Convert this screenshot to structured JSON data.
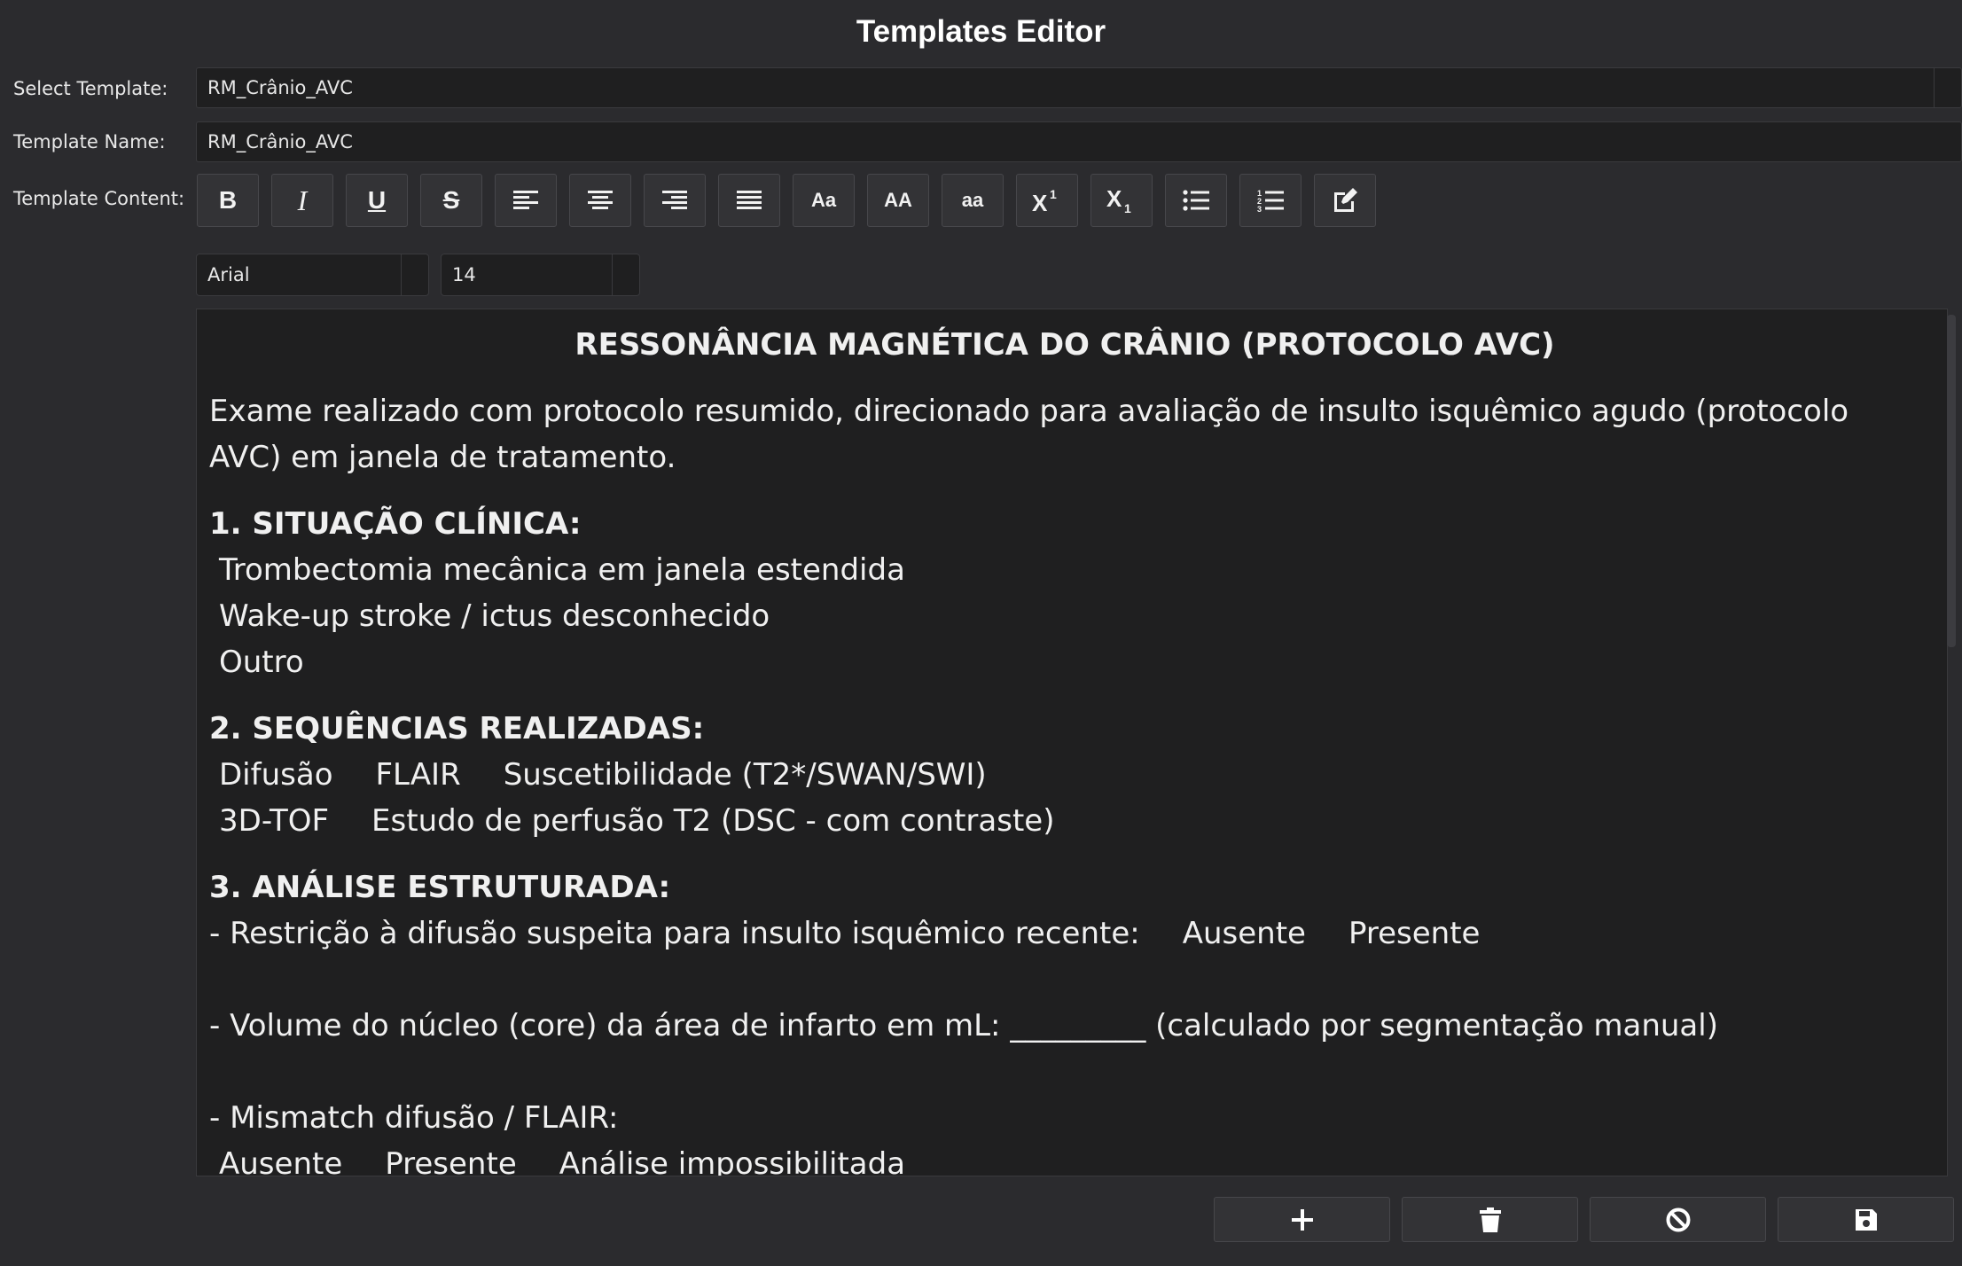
{
  "window": {
    "title": "Templates Editor"
  },
  "labels": {
    "select_template": "Select Template:",
    "template_name": "Template Name:",
    "template_content": "Template Content:"
  },
  "select_template": {
    "value": "RM_Crânio_AVC"
  },
  "template_name": {
    "value": "RM_Crânio_AVC"
  },
  "toolbar": {
    "buttons": [
      {
        "name": "bold-button",
        "icon": "bold-icon",
        "text": "B"
      },
      {
        "name": "italic-button",
        "icon": "italic-icon",
        "text": "I"
      },
      {
        "name": "underline-button",
        "icon": "underline-icon",
        "text": "U"
      },
      {
        "name": "strikethrough-button",
        "icon": "strikethrough-icon",
        "text": "S"
      },
      {
        "name": "align-left-button",
        "icon": "align-left-icon"
      },
      {
        "name": "align-center-button",
        "icon": "align-center-icon"
      },
      {
        "name": "align-right-button",
        "icon": "align-right-icon"
      },
      {
        "name": "justify-button",
        "icon": "justify-icon"
      },
      {
        "name": "capitalize-button",
        "text": "Aa"
      },
      {
        "name": "uppercase-button",
        "text": "AA"
      },
      {
        "name": "lowercase-button",
        "text": "aa"
      },
      {
        "name": "superscript-button",
        "icon": "superscript-icon"
      },
      {
        "name": "subscript-button",
        "icon": "subscript-icon"
      },
      {
        "name": "bullet-list-button",
        "icon": "bullet-list-icon"
      },
      {
        "name": "numbered-list-button",
        "icon": "numbered-list-icon"
      },
      {
        "name": "edit-button",
        "icon": "edit-icon"
      }
    ],
    "font_family": "Arial",
    "font_size": "14"
  },
  "document": {
    "heading": "RESSONÂNCIA MAGNÉTICA DO CRÂNIO (PROTOCOLO AVC)",
    "intro": "Exame realizado com protocolo resumido, direcionado para avaliação de insulto isquêmico agudo (protocolo AVC) em janela de tratamento.",
    "s1_title": "1. SITUAÇÃO CLÍNICA:",
    "s1_items": [
      "Trombectomia mecânica em janela estendida",
      "Wake-up stroke / ictus desconhecido",
      "Outro"
    ],
    "s2_title": "2. SEQUÊNCIAS REALIZADAS:",
    "s2_row1": [
      "Difusão",
      "FLAIR",
      "Suscetibilidade (T2*/SWAN/SWI)"
    ],
    "s2_row2": [
      "3D-TOF",
      "Estudo de perfusão T2 (DSC - com contraste)"
    ],
    "s3_title": "3. ANÁLISE ESTRUTURADA:",
    "s3_q1": "- Restrição à difusão suspeita para insulto isquêmico recente:",
    "s3_q1_opts": [
      "Ausente",
      "Presente"
    ],
    "s3_q2": "- Volume do núcleo (core) da área de infarto em mL: _________ (calculado por segmentação manual)",
    "s3_q3": "- Mismatch difusão / FLAIR:",
    "s3_q3_opts": [
      "Ausente",
      "Presente",
      "Análise impossibilitada"
    ]
  },
  "actions": [
    {
      "name": "add-button",
      "icon": "plus-icon"
    },
    {
      "name": "delete-button",
      "icon": "trash-icon"
    },
    {
      "name": "cancel-button",
      "icon": "ban-icon"
    },
    {
      "name": "save-button",
      "icon": "floppy-disk-icon"
    }
  ],
  "colors": {
    "background": "#2b2b2e",
    "field": "#1f1f20",
    "button": "#333336",
    "text": "#e8e8e8"
  }
}
